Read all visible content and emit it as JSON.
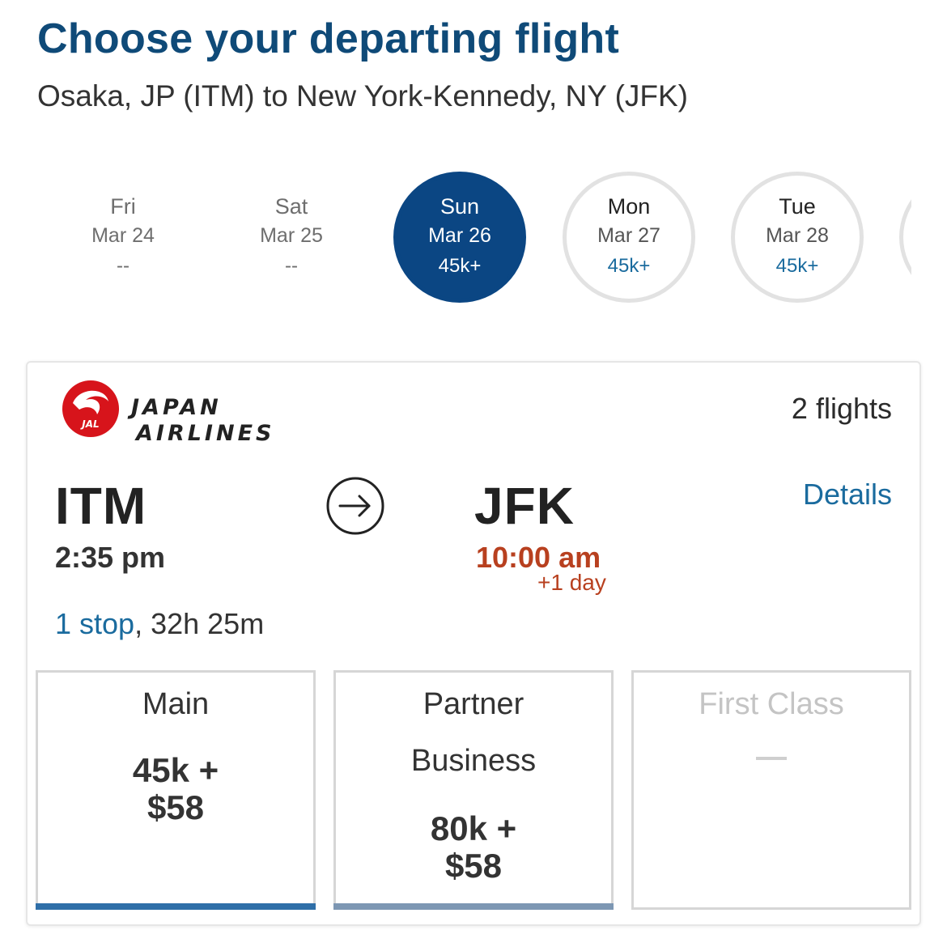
{
  "header": {
    "title": "Choose your departing flight",
    "route": "Osaka, JP (ITM) to New York-Kennedy, NY (JFK)"
  },
  "dates": [
    {
      "day": "Fri",
      "date": "Mar 24",
      "price": "--",
      "state": "unavailable"
    },
    {
      "day": "Sat",
      "date": "Mar 25",
      "price": "--",
      "state": "unavailable"
    },
    {
      "day": "Sun",
      "date": "Mar 26",
      "price": "45k+",
      "state": "selected"
    },
    {
      "day": "Mon",
      "date": "Mar 27",
      "price": "45k+",
      "state": "available"
    },
    {
      "day": "Tue",
      "date": "Mar 28",
      "price": "45k+",
      "state": "available"
    }
  ],
  "card": {
    "airline": {
      "line1": "JAPAN",
      "line2": "AIRLINES",
      "logo_text": "JAL"
    },
    "flights_count": "2 flights",
    "origin": {
      "code": "ITM",
      "time": "2:35 pm"
    },
    "destination": {
      "code": "JFK",
      "time": "10:00 am",
      "day_offset": "+1 day"
    },
    "details_label": "Details",
    "stops_label": "1 stop",
    "duration": ", 32h 25m",
    "fares": {
      "main": {
        "name": "Main",
        "price_line1": "45k +",
        "price_line2": "$58"
      },
      "partner": {
        "name_line1": "Partner",
        "name_line2": "Business",
        "price_line1": "80k +",
        "price_line2": "$58"
      },
      "first": {
        "name": "First Class"
      }
    }
  },
  "colors": {
    "title": "#0f4a78",
    "selected_date": "#0b4683",
    "link": "#1a6b9e",
    "arrival_time": "#b8401f",
    "jal_red": "#d7141b"
  }
}
